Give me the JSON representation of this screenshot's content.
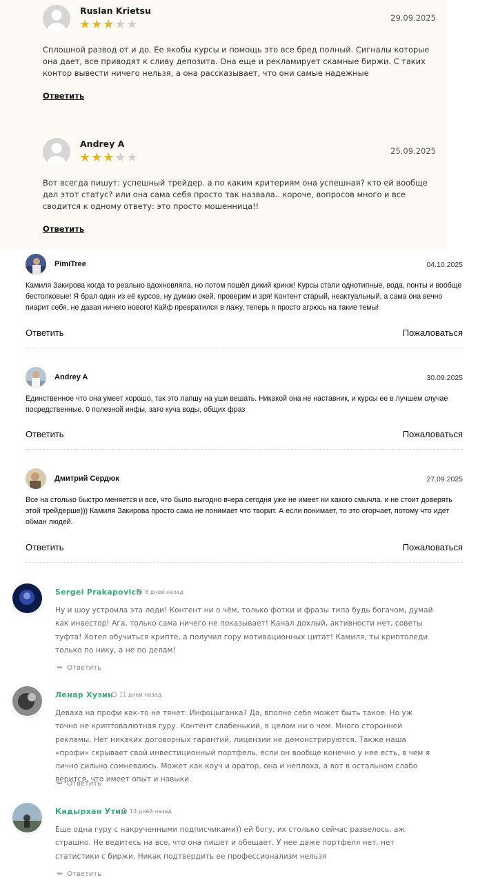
{
  "section1": {
    "reviews": [
      {
        "name": "Ruslan Krietsu",
        "date": "29.09.2025",
        "rating": 3,
        "max_rating": 5,
        "text": "Сплошной развод от и до. Ее якобы курсы и помощь это все бред полный. Сигналы которые она дает, все приводят к сливу депозита. Она еще и рекламирует скамные биржи. С таких контор вывести ничего нельзя, а она рассказывает, что они самые надежные",
        "reply_label": "Ответить"
      },
      {
        "name": "Andrey A",
        "date": "25.09.2025",
        "rating": 3,
        "max_rating": 5,
        "text": "Вот всегда пишут: успешный трейдер. а по каким критериям она успешная? кто ей вообще дал этот статус? или она сама себя просто так назвала.. короче, вопросов много и все сводится к одному ответу: это просто мошенница!!",
        "reply_label": "Ответить"
      }
    ]
  },
  "section2": {
    "comments": [
      {
        "name": "PimiTree",
        "date": "04.10.2025",
        "text": "Камиля Закирова когда то реально вдохновляла, но потом пошёл дикий кринж! Курсы стали однотипные, вода, понты и вообще бестолковые! Я брал один из её курсов, ну думаю окей, проверим и зря! Контент старый, неактуальный, а сама она вечно пиарит себя, не давая ничего нового! Кайф превратился в лажу, теперь я просто агрюсь на такие темы!",
        "reply_label": "Ответить",
        "complain_label": "Пожаловаться"
      },
      {
        "name": "Andrey A",
        "date": "30.09.2025",
        "text": "Единственное что она умеет хорошо, так это лапшу на уши вешать. Никакой она не наставник, и курсы ее в лучшем случае посредственные. 0 полезной инфы, зато куча воды, общих фраз",
        "reply_label": "Ответить",
        "complain_label": "Пожаловаться"
      },
      {
        "name": "Дмитрий Сердюк",
        "date": "27.09.2025",
        "text": "Все на столько быстро меняется и все, что было выгодно вчера сегодня уже не имеет ни какого смычла. и не стоит доверять этой трейдерше))) Камиля Закирова просто сама не понимает что творит. А если понимает, то это огорчает, потому что идет обман людей.",
        "reply_label": "Ответить",
        "complain_label": "Пожаловаться"
      }
    ]
  },
  "section3": {
    "accent_color": "#3aa87b",
    "comments": [
      {
        "name": "Sergei Prakapovich",
        "time": "8 дней назад",
        "text": "Ну и шоу устроила эта леди! Контент ни о чём, только фотки и фразы типа будь богачом, думай как инвестор! Ага, только сама ничего не показывает! Канал дохлый, активности нет, советы туфта! Хотел обучиться крипте, а получил гору мотивационных цитат! Камиля, ты криптоледи только по нику, а не по делам!",
        "reply_label": "Ответить"
      },
      {
        "name": "Ленар Хузин",
        "time": "11 дней назад",
        "text": "Деваха на профи как-то не тянет. Инфоцыганка? Да, вполне себе может быть такое. Но уж точно не криптовалютная гуру. Контент слабенький, в целом ни о чем. Много сторонней рекламы. Нет никаких договорных гарантий, лицензии не демонстрируются. Также наша «профи» скрывает свой инвестиционный портфель, если он вообще конечно у нее есть, в чем я лично сильно сомневаюсь. Может как коуч и оратор, она и неплоха, а вот в остальном слабо верится, что имеет опыт и навыки.",
        "reply_label": "Ответить"
      },
      {
        "name": "Кадырхан Утин",
        "time": "13 дней назад",
        "text": "Еще одна гуру с накрученными подписчиками)) ей богу, их столько сейчас развелось, аж страшно. Не ведитесь на все, что она пишет и обещает. У нее даже портфеля нет, нет статистики с биржи. Никак подтвердить ее профессионализм нельзя",
        "reply_label": "Ответить"
      }
    ]
  }
}
